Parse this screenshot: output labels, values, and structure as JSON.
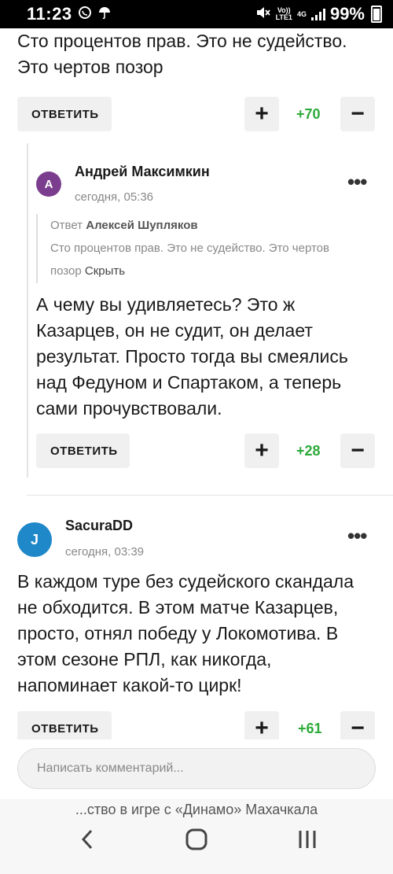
{
  "status": {
    "time": "11:23",
    "battery": "99%",
    "net_top": "Vo))",
    "net_bottom": "LTE1",
    "gen": "4G"
  },
  "comments": {
    "top": {
      "text_line1": "Сто процентов прав. Это не судейство.",
      "text_line2": "Это чертов позор",
      "reply": "ОТВЕТИТЬ",
      "score": "+70"
    },
    "reply1": {
      "avatar_letter": "А",
      "avatar_color": "#7b3e8f",
      "author": "Андрей Максимкин",
      "time": "сегодня, 05:36",
      "quote_prefix": "Ответ",
      "quote_author": "Алексей Шупляков",
      "quote_text1": "Сто процентов прав. Это не судейство. Это чертов",
      "quote_text2": "позор",
      "quote_hide": "Скрыть",
      "lines": [
        "А чему вы удивляетесь? Это ж",
        "Казарцев, он не судит, он делает",
        "результат. Просто тогда вы смеялись",
        "над Федуном и Спартаком, а теперь",
        "сами прочувствовали."
      ],
      "reply": "ОТВЕТИТЬ",
      "score": "+28"
    },
    "second": {
      "avatar_letter": "J",
      "avatar_color": "#1e88c9",
      "author": "SacuraDD",
      "time": "сегодня, 03:39",
      "lines": [
        "В каждом туре без судейского скандала",
        "не обходится. В этом матче Казарцев,",
        "просто, отнял победу у Локомотива. В",
        "этом сезоне РПЛ, как никогда,",
        "напоминает какой-то цирк!"
      ],
      "reply": "ОТВЕТИТЬ",
      "score": "+61"
    }
  },
  "vote": {
    "plus": "+",
    "minus": "−"
  },
  "input": {
    "placeholder": "Написать комментарий..."
  },
  "page_title": "...ство в игре с «Динамо» Махачкала",
  "nav": {
    "back": "‹",
    "home": "○",
    "recents": "|||"
  }
}
